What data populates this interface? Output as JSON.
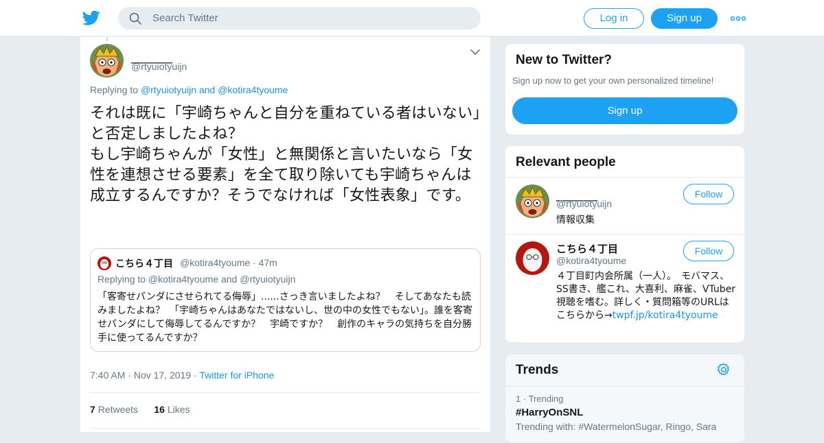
{
  "header": {
    "search_placeholder": "Search Twitter",
    "login_label": "Log in",
    "signup_label": "Sign up"
  },
  "tweet": {
    "author_name": "＿＿＿＿",
    "author_handle": "@rtyuiotyuijn",
    "replying_prefix": "Replying to",
    "replying_to_1": "@rtyuiotyuijn",
    "replying_and": "and",
    "replying_to_2": "@kotira4tyoume",
    "text": "それは既に「宇崎ちゃんと自分を重ねている者はいない」と否定しましたよね？\nもし宇崎ちゃんが「女性」と無関係と言いたいなら「女性を連想させる要素」を全て取り除いても宇崎ちゃんは成立するんですか？そうでなければ「女性表象」です。",
    "time": "7:40 AM",
    "date": "Nov 17, 2019",
    "source": "Twitter for iPhone",
    "retweets_count": "7",
    "retweets_label": "Retweets",
    "likes_count": "16",
    "likes_label": "Likes"
  },
  "quoted": {
    "name": "こちら４丁目",
    "handle": "@kotira4tyoume",
    "age": "47m",
    "replying_prefix": "Replying to",
    "replying_to_1": "@kotira4tyoume",
    "replying_and": "and",
    "replying_to_2": "@rtyuiotyuijn",
    "text": "「客寄せパンダにさせられてる侮辱」......さっき言いましたよね？　そしてあなたも読みましたよね？　「宇崎ちゃんはあなたではないし、世の中の女性でもない」。誰を客寄せパンダにして侮辱してるんですか？　宇崎ですか？　創作のキャラの気持ちを自分勝手に使ってるんですか？"
  },
  "new_to_twitter": {
    "title": "New to Twitter?",
    "subtitle": "Sign up now to get your own personalized timeline!",
    "signup_label": "Sign up"
  },
  "relevant_people": {
    "title": "Relevant people",
    "people": [
      {
        "name": "＿＿＿＿",
        "handle": "@rtyuiotyuijn",
        "bio": "情報収集",
        "follow_label": "Follow"
      },
      {
        "name": "こちら４丁目",
        "handle": "@kotira4tyoume",
        "bio": "４丁目町内会所属（一人）。　モバマス、SS書き、艦これ、大喜利、麻雀、VTuber視聴を嗜む。詳しく・質問箱等のURLはこちらから→",
        "bio_link": "twpf.jp/kotira4tyoume",
        "follow_label": "Follow"
      }
    ]
  },
  "trends": {
    "title": "Trends",
    "items": [
      {
        "rank": "1",
        "label": "Trending",
        "tag": "#HarryOnSNL",
        "with_prefix": "Trending with:",
        "with_tags": "#WatermelonSugar, Ringo, Sara"
      }
    ]
  },
  "colors": {
    "accent": "#1da1f2",
    "link": "#1b95e0",
    "muted": "#657786",
    "background": "#e6ecf0"
  },
  "icons": [
    "twitter-logo-icon",
    "search-icon",
    "more-icon",
    "chevron-down-icon",
    "gear-icon"
  ]
}
